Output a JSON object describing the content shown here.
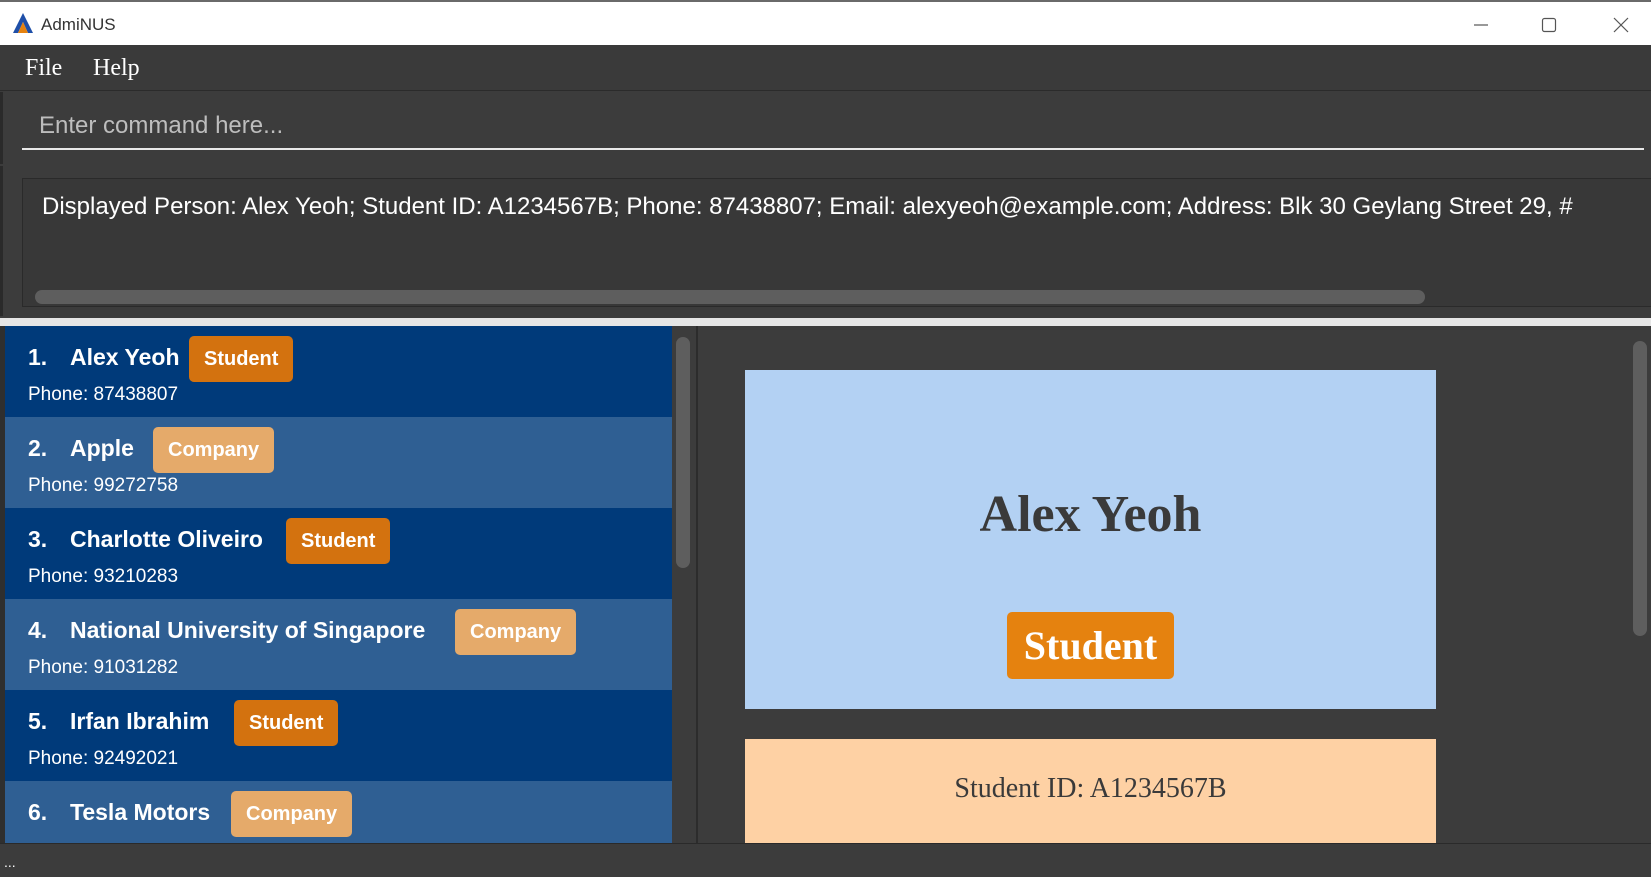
{
  "window": {
    "title": "AdmiNUS",
    "controls": [
      "minimize-icon",
      "maximize-icon",
      "close-icon"
    ]
  },
  "menu": {
    "file_label": "File",
    "help_label": "Help"
  },
  "command": {
    "placeholder": "Enter command here...",
    "value": ""
  },
  "result": {
    "text": "Displayed Person: Alex Yeoh; Student ID: A1234567B; Phone: 87438807; Email: alexyeoh@example.com; Address: Blk 30 Geylang Street 29, #"
  },
  "persons": [
    {
      "index": "1.",
      "name": "Alex Yeoh",
      "tag": "Student",
      "phone": "Phone: 87438807"
    },
    {
      "index": "2.",
      "name": "Apple",
      "tag": "Company",
      "phone": "Phone: 99272758"
    },
    {
      "index": "3.",
      "name": "Charlotte Oliveiro",
      "tag": "Student",
      "phone": "Phone: 93210283"
    },
    {
      "index": "4.",
      "name": "National University of Singapore",
      "tag": "Company",
      "phone": "Phone: 91031282"
    },
    {
      "index": "5.",
      "name": "Irfan Ibrahim",
      "tag": "Student",
      "phone": "Phone: 92492021"
    },
    {
      "index": "6.",
      "name": "Tesla Motors",
      "tag": "Company",
      "phone": ""
    }
  ],
  "detail": {
    "name": "Alex Yeoh",
    "tag": "Student",
    "student_id": "Student ID: A1234567B"
  },
  "status": {
    "text": "..."
  },
  "colors": {
    "student_tag": "#d3720f",
    "company_tag": "#e5aa6a",
    "card_dark": "#003a7a",
    "card_light": "#2f5f93",
    "detail_card": "#b3d1f3",
    "detail_id_box": "#fed1a4"
  }
}
